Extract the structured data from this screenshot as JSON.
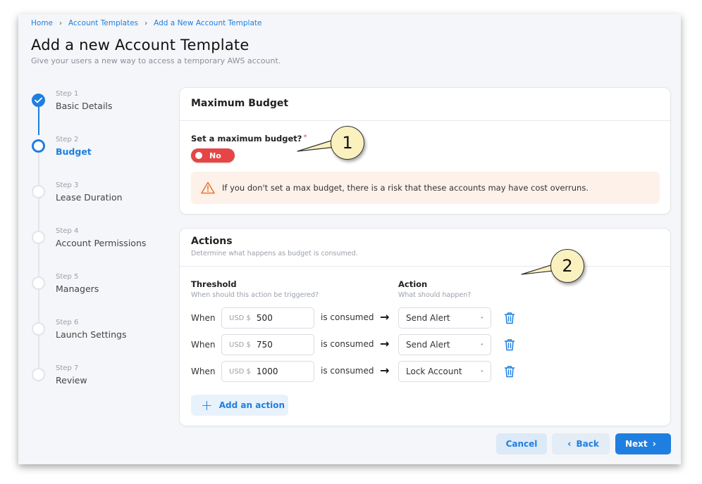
{
  "breadcrumb": [
    "Home",
    "Account Templates",
    "Add a New Account Template"
  ],
  "breadcrumb_separator": "›",
  "page": {
    "title": "Add a new Account Template",
    "subtitle": "Give your users a new way to access a temporary AWS account."
  },
  "steps": [
    {
      "num": "Step 1",
      "label": "Basic Details",
      "state": "done"
    },
    {
      "num": "Step 2",
      "label": "Budget",
      "state": "current"
    },
    {
      "num": "Step 3",
      "label": "Lease Duration",
      "state": "pending"
    },
    {
      "num": "Step 4",
      "label": "Account Permissions",
      "state": "pending"
    },
    {
      "num": "Step 5",
      "label": "Managers",
      "state": "pending"
    },
    {
      "num": "Step 6",
      "label": "Launch Settings",
      "state": "pending"
    },
    {
      "num": "Step 7",
      "label": "Review",
      "state": "pending"
    }
  ],
  "budget": {
    "title": "Maximum Budget",
    "question": "Set a maximum budget?",
    "required_mark": "*",
    "toggle_label": "No",
    "warning": "If you don't set a max budget, there is a risk that these accounts may have cost overruns."
  },
  "actions": {
    "title": "Actions",
    "description": "Determine what happens as budget is consumed.",
    "threshold_header": "Threshold",
    "threshold_sub": "When should this action be triggered?",
    "action_header": "Action",
    "action_sub": "What should happen?",
    "rows": [
      {
        "when": "When",
        "prefix": "USD $",
        "amount": "500",
        "consumed": "is consumed",
        "action": "Send Alert"
      },
      {
        "when": "When",
        "prefix": "USD $",
        "amount": "750",
        "consumed": "is consumed",
        "action": "Send Alert"
      },
      {
        "when": "When",
        "prefix": "USD $",
        "amount": "1000",
        "consumed": "is consumed",
        "action": "Lock Account"
      }
    ],
    "add_label": "Add an action"
  },
  "footer": {
    "cancel": "Cancel",
    "back": "Back",
    "next": "Next"
  },
  "callouts": [
    "1",
    "2"
  ],
  "colors": {
    "accent": "#1f7fe0",
    "danger": "#e64545",
    "warning_bg": "#fdf1ea",
    "warning_icon": "#e8792d"
  }
}
